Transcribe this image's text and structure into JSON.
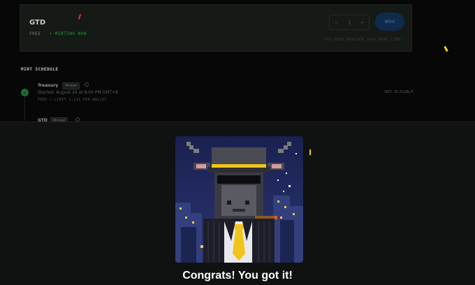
{
  "card": {
    "title": "GTD",
    "price": "FREE",
    "status": "• MINTING NOW",
    "stepper_minus": "−",
    "stepper_value": "1",
    "stepper_plus": "+",
    "mint_label": "Mint",
    "note": "YOU HAVE REACHED YOUR MINT LIMIT"
  },
  "schedule": {
    "title": "MINT SCHEDULE",
    "phases": [
      {
        "name": "Treasury",
        "badge": "Minted",
        "started": "Started: August 26 at 8:00 PM GMT+8",
        "limit": "FREE | LIMIT 1,111 PER WALLET",
        "eligibility": "NOT ELIGIBLE"
      },
      {
        "name": "GTD",
        "badge": "Minted"
      }
    ]
  },
  "modal": {
    "image_alt": "pixel art goat with top hat and sunglasses",
    "message": "Congrats! You got it!"
  },
  "colors": {
    "accent_green": "#1f9a3b",
    "mint_button": "#0f2a4a",
    "tie_yellow": "#f0c419"
  }
}
